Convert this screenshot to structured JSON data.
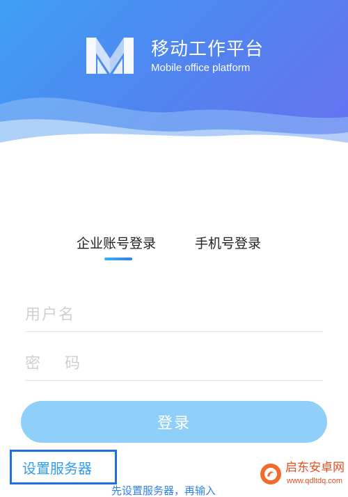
{
  "header": {
    "title": "移动工作平台",
    "subtitle": "Mobile office platform",
    "logo_icon": "m-logo-icon"
  },
  "tabs": [
    {
      "label": "企业账号登录",
      "active": true
    },
    {
      "label": "手机号登录",
      "active": false
    }
  ],
  "form": {
    "username_placeholder": "用户名",
    "username_value": "",
    "password_placeholder": "密 码",
    "password_value": "",
    "login_label": "登录"
  },
  "footer": {
    "server_link": "设置服务器",
    "hint": "先设置服务器，再输入"
  },
  "watermark": {
    "name": "启东安卓网",
    "url": "www.qdltdq.com"
  },
  "colors": {
    "accent": "#2f9cf0",
    "button": "#90cff9",
    "highlight_box": "#1f6fe0",
    "watermark": "#e54d1e"
  }
}
